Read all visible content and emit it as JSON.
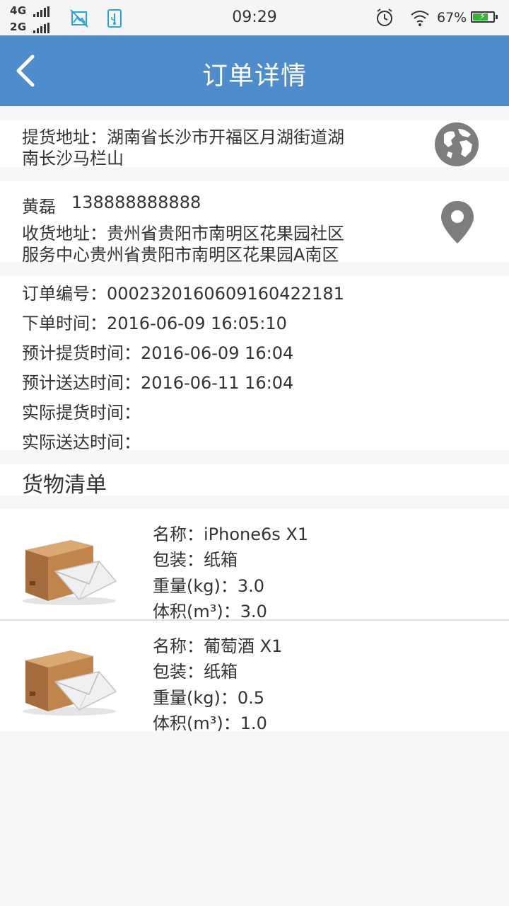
{
  "status_bar": {
    "network_1": "4G",
    "network_2": "2G",
    "time": "09:29",
    "battery_percent": "67%"
  },
  "app_bar": {
    "title": "订单详情",
    "back_icon": "chevron-left-icon"
  },
  "pickup": {
    "line1": "提货地址：湖南省长沙市开福区月湖街道湖",
    "line2": "南长沙马栏山",
    "icon": "globe-icon"
  },
  "receiver": {
    "name": "黄磊",
    "phone": "138888888888",
    "line1": "收货地址：贵州省贵阳市南明区花果园社区",
    "line2": "服务中心贵州省贵阳市南明区花果园A南区",
    "icon": "location-pin-icon"
  },
  "order_info": {
    "order_no": "订单编号：00023201606091604221 81",
    "created": "下单时间：2016-06-09 16:05:10",
    "est_pickup": "预计提货时间：2016-06-09 16:04",
    "est_delivery": "预计送达时间：2016-06-11 16:04",
    "actual_pickup": "实际提货时间：",
    "actual_delivery": "实际送达时间："
  },
  "goods": {
    "title": "货物清单",
    "items": [
      {
        "name": "名称：iPhone6s X1",
        "packaging": "包装：纸箱",
        "weight": "重量(kg)：3.0",
        "volume": "体积(m³)：3.0"
      },
      {
        "name": "名称：葡萄酒 X1",
        "packaging": "包装：纸箱",
        "weight": "重量(kg)：0.5",
        "volume": "体积(m³)：1.0"
      }
    ]
  }
}
